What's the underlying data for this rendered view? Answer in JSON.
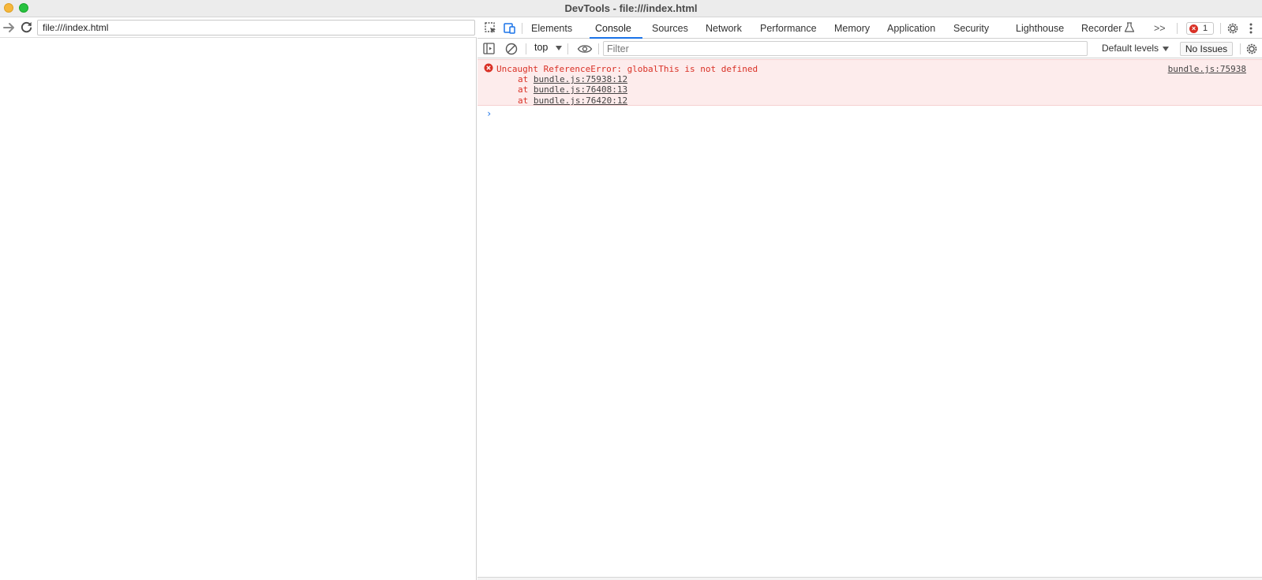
{
  "window": {
    "title": "DevTools - file:///index.html"
  },
  "browser": {
    "url": "file:///index.html"
  },
  "devtools": {
    "tabs": [
      {
        "label": "Elements"
      },
      {
        "label": "Console"
      },
      {
        "label": "Sources"
      },
      {
        "label": "Network"
      },
      {
        "label": "Performance"
      },
      {
        "label": "Memory"
      },
      {
        "label": "Application"
      },
      {
        "label": "Security"
      },
      {
        "label": "Lighthouse"
      },
      {
        "label": "Recorder"
      }
    ],
    "active_tab": "Console",
    "more_tabs_label": ">>",
    "error_count": "1"
  },
  "console_toolbar": {
    "context": "top",
    "filter_placeholder": "Filter",
    "levels": "Default levels",
    "issues": "No Issues"
  },
  "console": {
    "error": {
      "message": "Uncaught ReferenceError: globalThis is not defined",
      "source": "bundle.js:75938",
      "stack": [
        {
          "prefix": "at",
          "location": "bundle.js:75938:12"
        },
        {
          "prefix": "at",
          "location": "bundle.js:76408:13"
        },
        {
          "prefix": "at",
          "location": "bundle.js:76420:12"
        }
      ]
    },
    "prompt": "›"
  },
  "colors": {
    "accent": "#1a73e8",
    "error_text": "#d93025",
    "error_background": "#fdecec"
  }
}
